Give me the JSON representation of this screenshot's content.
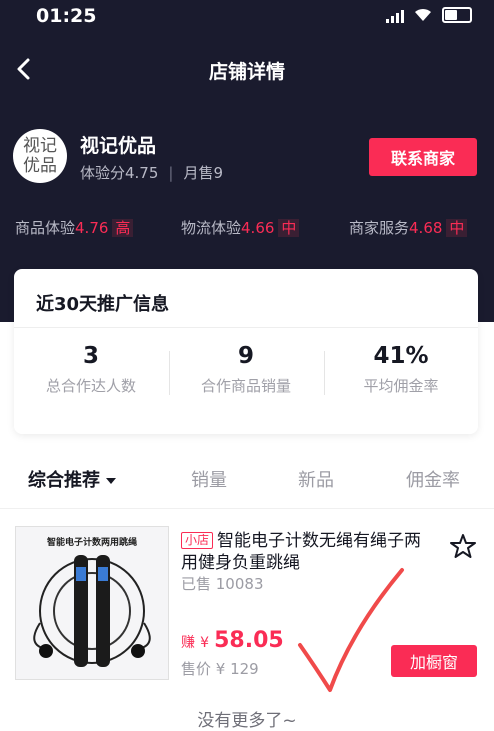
{
  "status_bar": {
    "time": "01:25"
  },
  "nav": {
    "title": "店铺详情"
  },
  "shop": {
    "avatar_text": "视记优品",
    "name": "视记优品",
    "experience_score": "体验分4.75",
    "monthly_sales": "月售9",
    "contact_button": "联系商家"
  },
  "ratings": [
    {
      "label": "商品体验",
      "value": "4.76",
      "level": "高"
    },
    {
      "label": "物流体验",
      "value": "4.66",
      "level": "中"
    },
    {
      "label": "商家服务",
      "value": "4.68",
      "level": "中"
    }
  ],
  "promo": {
    "title": "近30天推广信息",
    "metrics": [
      {
        "value": "3",
        "label": "总合作达人数"
      },
      {
        "value": "9",
        "label": "合作商品销量"
      },
      {
        "value": "41%",
        "label": "平均佣金率"
      }
    ]
  },
  "sort_tabs": [
    "综合推荐",
    "销量",
    "新品",
    "佣金率"
  ],
  "product": {
    "image_caption": "智能电子计数两用跳绳",
    "tag": "小店",
    "title": "智能电子计数无绳有绳子两用健身负重跳绳",
    "sold": "已售 10083",
    "earn_label": "赚",
    "earn_currency": "¥",
    "earn_amount": "58.05",
    "price": "售价 ¥ 129",
    "add_button": "加橱窗"
  },
  "footer": {
    "no_more": "没有更多了~"
  },
  "colors": {
    "accent": "#fa2c55",
    "header_bg": "#1a1b2e"
  }
}
